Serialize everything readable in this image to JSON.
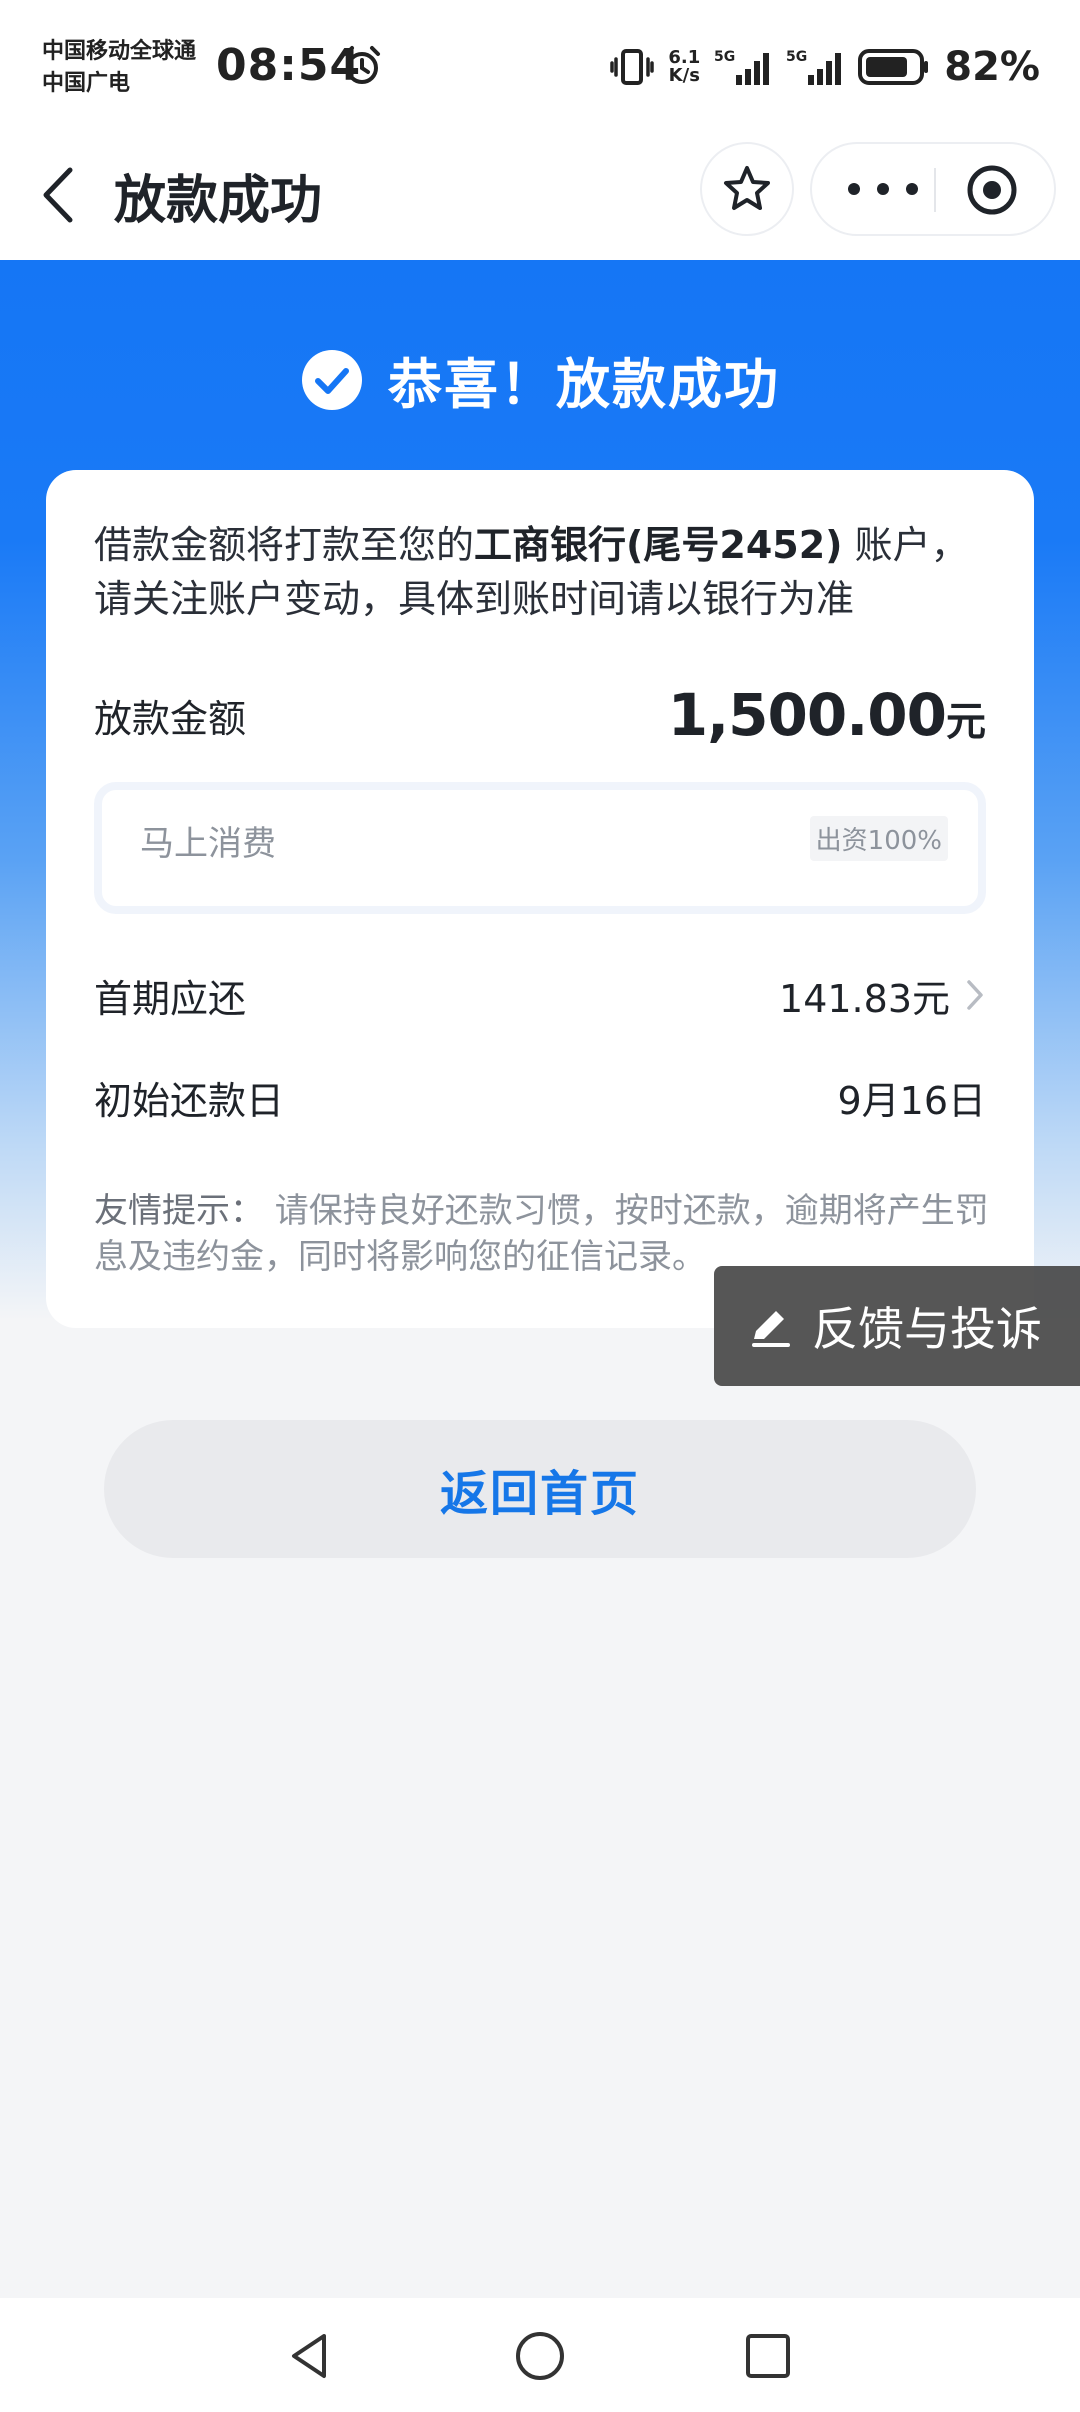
{
  "status_bar": {
    "carrier_line1": "中国移动全球通",
    "carrier_line2": "中国广电",
    "time": "08:54",
    "net_speed_value": "6.1",
    "net_speed_unit": "K/s",
    "signal1_label": "5G",
    "signal2_label": "5G",
    "battery_percent": "82%",
    "battery_level": 0.82
  },
  "nav": {
    "title": "放款成功"
  },
  "hero": {
    "headline": "恭喜！放款成功"
  },
  "card": {
    "notice_prefix": "借款金额将打款至您的",
    "notice_bank": "工商银行(尾号2452)",
    "notice_suffix": " 账户，请关注账户变动，具体到账时间请以银行为准",
    "amount_label": "放款金额",
    "amount_value": "1,500.00",
    "amount_unit": "元",
    "funder_name": "马上消费",
    "funder_share": "出资100%",
    "first_repay_label": "首期应还",
    "first_repay_value": "141.83元",
    "repay_date_label": "初始还款日",
    "repay_date_value": "9月16日",
    "tips_label": "友情提示：",
    "tips_text": " 请保持良好还款习惯，按时还款，逾期将产生罚息及违约金，同时将影响您的征信记录。"
  },
  "feedback": {
    "label": "反馈与投诉"
  },
  "actions": {
    "home_label": "返回首页"
  },
  "colors": {
    "brand_blue": "#1576f5",
    "link_blue": "#1677e8",
    "feedback_bg": "#484848"
  },
  "icons": {
    "alarm": "alarm-clock-icon",
    "back": "chevron-left-icon",
    "favorite": "star-icon",
    "more": "more-dots-icon",
    "close_app": "target-circle-icon",
    "success": "check-circle-icon",
    "chevron": "chevron-right-icon",
    "feedback": "pencil-icon"
  }
}
